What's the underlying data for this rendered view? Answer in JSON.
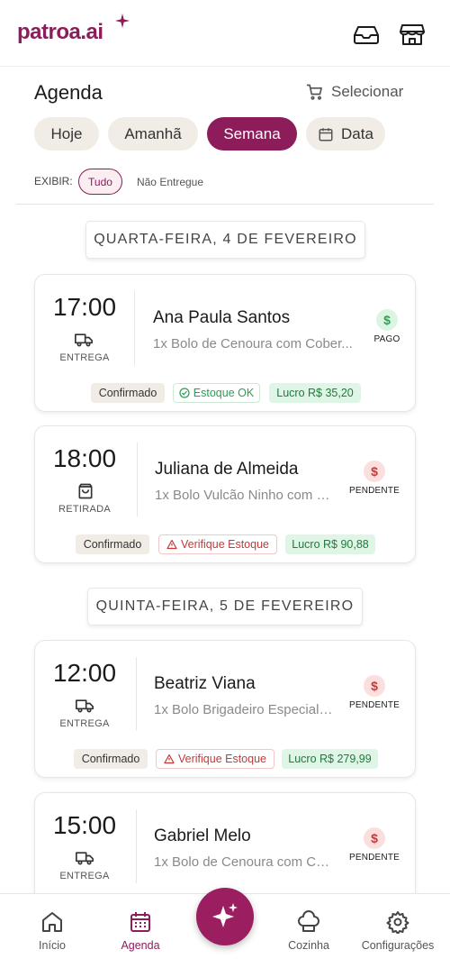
{
  "header": {
    "logo_text": "patroa.ai",
    "icons": [
      "inbox-icon",
      "store-icon"
    ]
  },
  "agenda": {
    "title": "Agenda",
    "select_label": "Selecionar",
    "chips": [
      {
        "label": "Hoje",
        "active": false
      },
      {
        "label": "Amanhã",
        "active": false
      },
      {
        "label": "Semana",
        "active": true
      },
      {
        "label": "Data",
        "active": false,
        "icon": "calendar-icon"
      }
    ],
    "filter": {
      "label": "EXIBIR:",
      "options": [
        {
          "label": "Tudo",
          "active": true
        },
        {
          "label": "Não Entregue",
          "active": false
        }
      ]
    }
  },
  "days": [
    {
      "header": "QUARTA-FEIRA, 4 DE FEVEREIRO",
      "orders": [
        {
          "time": "17:00",
          "type": "ENTREGA",
          "type_icon": "truck-icon",
          "name": "Ana Paula Santos",
          "desc": "1x Bolo de Cenoura com Cober...",
          "payment": "PAGO",
          "payment_icon": "dollar-icon",
          "status": "Confirmado",
          "stock": "Estoque OK",
          "stock_ok": true,
          "profit": "Lucro R$ 35,20"
        },
        {
          "time": "18:00",
          "type": "RETIRADA",
          "type_icon": "bag-icon",
          "name": "Juliana de Almeida",
          "desc": "1x Bolo Vulcão Ninho com N...",
          "payment": "PENDENTE",
          "payment_icon": "dollar-icon",
          "status": "Confirmado",
          "stock": "Verifique Estoque",
          "stock_ok": false,
          "profit": "Lucro R$ 90,88"
        }
      ]
    },
    {
      "header": "QUINTA-FEIRA, 5 DE FEVEREIRO",
      "orders": [
        {
          "time": "12:00",
          "type": "ENTREGA",
          "type_icon": "truck-icon",
          "name": "Beatriz Viana",
          "desc": "1x Bolo Brigadeiro Especial, ...",
          "payment": "PENDENTE",
          "payment_icon": "dollar-icon",
          "status": "Confirmado",
          "stock": "Verifique Estoque",
          "stock_ok": false,
          "profit": "Lucro R$ 279,99"
        },
        {
          "time": "15:00",
          "type": "ENTREGA",
          "type_icon": "truck-icon",
          "name": "Gabriel Melo",
          "desc": "1x Bolo de Cenoura com Co...",
          "payment": "PENDENTE",
          "payment_icon": "dollar-icon"
        }
      ]
    }
  ],
  "nav": [
    {
      "label": "Início",
      "icon": "home-icon",
      "active": false
    },
    {
      "label": "Agenda",
      "icon": "calendar-icon",
      "active": true
    },
    {
      "label": "Cozinha",
      "icon": "chef-hat-icon",
      "active": false
    },
    {
      "label": "Configurações",
      "icon": "gear-icon",
      "active": false
    }
  ],
  "fab_icon": "sparkle-icon",
  "colors": {
    "brand": "#8c1d5a",
    "paid": "#2e9d55",
    "pending": "#c43a3a",
    "chip_bg": "#f2ece7",
    "profit_bg": "#dff5e5"
  }
}
